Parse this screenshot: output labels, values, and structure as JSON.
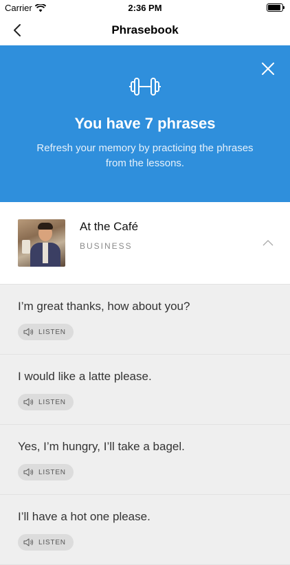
{
  "status_bar": {
    "carrier": "Carrier",
    "time": "2:36 PM"
  },
  "nav": {
    "title": "Phrasebook"
  },
  "banner": {
    "title": "You have 7 phrases",
    "subtitle": "Refresh your memory by practicing the phrases from the lessons.",
    "background_color": "#2f8fdc",
    "icon": "dumbbell-icon"
  },
  "lesson": {
    "title": "At the Café",
    "category": "BUSINESS"
  },
  "phrases": [
    {
      "text": "I’m great thanks, how about you?",
      "listen_label": "LISTEN"
    },
    {
      "text": "I would like a latte please.",
      "listen_label": "LISTEN"
    },
    {
      "text": "Yes, I’m hungry, I’ll take a bagel.",
      "listen_label": "LISTEN"
    },
    {
      "text": "I’ll have a hot one please.",
      "listen_label": "LISTEN"
    }
  ]
}
